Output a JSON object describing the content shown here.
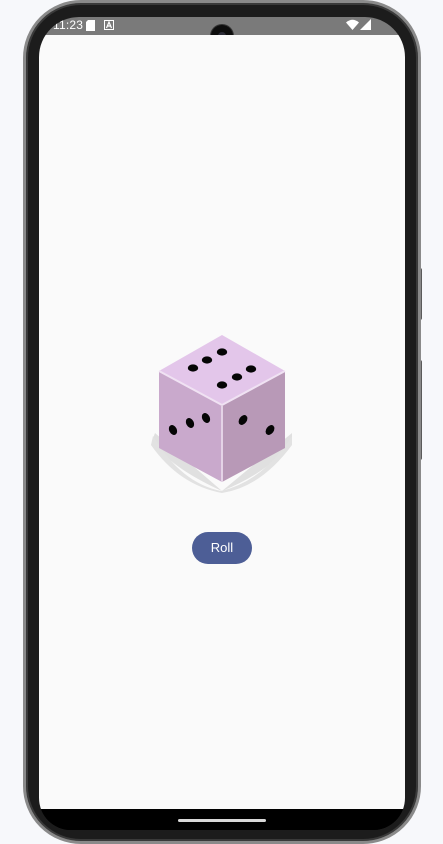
{
  "status_bar": {
    "time": "11:23",
    "left_icons": [
      "sd-card-icon",
      "a-notification-icon"
    ],
    "right_icons": [
      "wifi-icon",
      "cell-signal-icon"
    ]
  },
  "app": {
    "dice_image": {
      "icon": "dice-icon",
      "top_face_pips": 6,
      "left_face_pips": 3,
      "right_face_pips": 2,
      "colors": {
        "top": "#e3c6ea",
        "left": "#c9a9cc",
        "right": "#b899b7",
        "pip": "#050505",
        "shadow": "#e0e0e0"
      }
    },
    "roll_button": {
      "label": "Roll",
      "color": "#4d5e96",
      "text_color": "#ffffff"
    }
  },
  "colors": {
    "background": "#fafafa",
    "status_bar": "#7a7a7a",
    "frame": "#1c1c1c"
  }
}
